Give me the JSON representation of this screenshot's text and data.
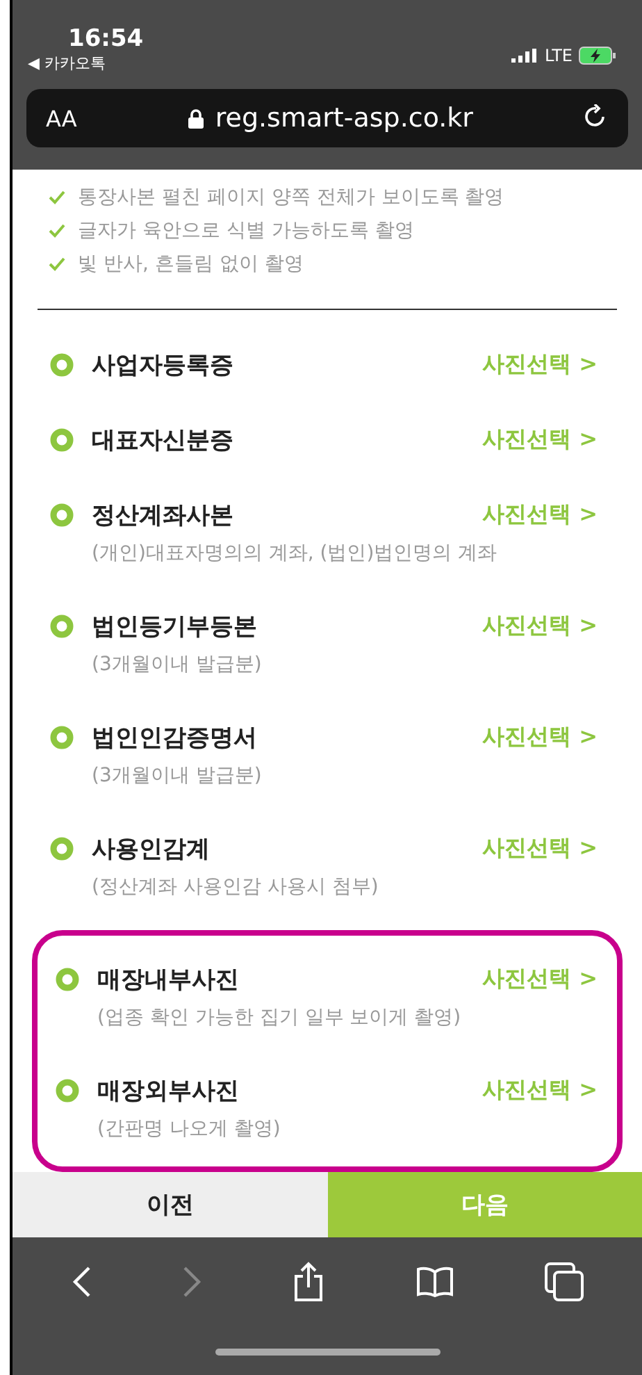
{
  "status_bar": {
    "time": "16:54",
    "back_app": "◀ 카카오톡",
    "network": "LTE"
  },
  "address_bar": {
    "text_size": "AA",
    "url": "reg.smart-asp.co.kr"
  },
  "checklist": [
    "통장사본 펼친 페이지 양쪽 전체가 보이도록 촬영",
    "글자가 육안으로 식별 가능하도록 촬영",
    "빛 반사, 흔들림 없이 촬영"
  ],
  "documents": [
    {
      "title": "사업자등록증",
      "action": "사진선택 >",
      "highlighted": false
    },
    {
      "title": "대표자신분증",
      "action": "사진선택 >",
      "highlighted": false
    },
    {
      "title": "정산계좌사본",
      "note": "(개인)대표자명의의 계좌, (법인)법인명의 계좌",
      "action": "사진선택 >",
      "highlighted": false
    },
    {
      "title": "법인등기부등본",
      "note": "(3개월이내 발급분)",
      "action": "사진선택 >",
      "highlighted": false
    },
    {
      "title": "법인인감증명서",
      "note": "(3개월이내 발급분)",
      "action": "사진선택 >",
      "highlighted": false
    },
    {
      "title": "사용인감계",
      "note": "(정산계좌 사용인감 사용시 첨부)",
      "action": "사진선택 >",
      "highlighted": false
    },
    {
      "title": "매장내부사진",
      "note": "(업종 확인 가능한 집기 일부 보이게 촬영)",
      "action": "사진선택 >",
      "highlighted": true
    },
    {
      "title": "매장외부사진",
      "note": "(간판명 나오게 촬영)",
      "action": "사진선택 >",
      "highlighted": true
    }
  ],
  "buttons": {
    "prev": "이전",
    "next": "다음"
  }
}
